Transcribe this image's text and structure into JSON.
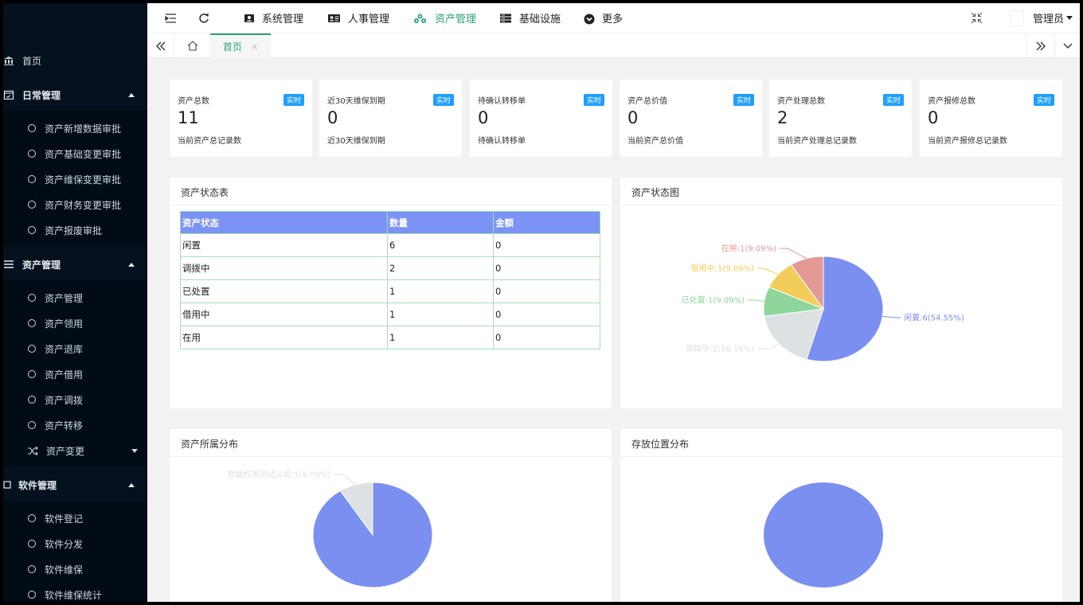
{
  "sidebar": {
    "home": "首页",
    "groups": [
      {
        "label": "日常管理",
        "items": [
          "资产新增数据审批",
          "资产基础变更审批",
          "资产维保变更审批",
          "资产财务变更审批",
          "资产报废审批"
        ]
      },
      {
        "label": "资产管理",
        "items": [
          "资产管理",
          "资产领用",
          "资产退库",
          "资产借用",
          "资产调拨",
          "资产转移",
          "资产变更"
        ]
      },
      {
        "label": "软件管理",
        "items": [
          "软件登记",
          "软件分发",
          "软件维保",
          "软件维保统计"
        ]
      }
    ]
  },
  "topbar": {
    "menus": [
      "系统管理",
      "人事管理",
      "资产管理",
      "基础设施",
      "更多"
    ],
    "active": "资产管理",
    "user": "管理员"
  },
  "tabs": {
    "home_tab": "首页"
  },
  "stats": [
    {
      "title": "资产总数",
      "badge": "实时",
      "value": "11",
      "desc": "当前资产总记录数"
    },
    {
      "title": "近30天维保到期",
      "badge": "实时",
      "value": "0",
      "desc": "近30天维保到期"
    },
    {
      "title": "待确认转移单",
      "badge": "实时",
      "value": "0",
      "desc": "待确认转移单"
    },
    {
      "title": "资产总价值",
      "badge": "实时",
      "value": "0",
      "desc": "当前资产总价值"
    },
    {
      "title": "资产处理总数",
      "badge": "实时",
      "value": "2",
      "desc": "当前资产处理总记录数"
    },
    {
      "title": "资产报修总数",
      "badge": "实时",
      "value": "0",
      "desc": "当前资产报修总记录数"
    }
  ],
  "status_table": {
    "title": "资产状态表",
    "headers": [
      "资产状态",
      "数量",
      "金额"
    ],
    "rows": [
      [
        "闲置",
        "6",
        "0"
      ],
      [
        "调拨中",
        "2",
        "0"
      ],
      [
        "已处置",
        "1",
        "0"
      ],
      [
        "借用中",
        "1",
        "0"
      ],
      [
        "在用",
        "1",
        "0"
      ]
    ]
  },
  "panels": {
    "status_chart": "资产状态图",
    "owner_chart": "资产所属分布",
    "location_chart": "存放位置分布"
  },
  "chart_data": [
    {
      "type": "pie",
      "title": "资产状态图",
      "slices": [
        {
          "label": "闲置:6(54.55%)",
          "value": 6,
          "color": "#7b8ff0"
        },
        {
          "label": "调拨中:2(18.18%)",
          "value": 2,
          "color": "#dde1e4"
        },
        {
          "label": "已处置:1(9.09%)",
          "value": 1,
          "color": "#8fd69c"
        },
        {
          "label": "借用中:1(9.09%)",
          "value": 1,
          "color": "#f2cd5c"
        },
        {
          "label": "在用:1(9.09%)",
          "value": 1,
          "color": "#e39a94"
        }
      ]
    },
    {
      "type": "pie",
      "title": "资产所属分布",
      "slices": [
        {
          "label": "",
          "value": 10,
          "color": "#7b8ff0"
        },
        {
          "label": "数据权限测试公司:1(9.09%)",
          "value": 1,
          "color": "#dde1e4"
        }
      ]
    },
    {
      "type": "pie",
      "title": "存放位置分布",
      "slices": [
        {
          "label": "",
          "value": 11,
          "color": "#7b8ff0"
        }
      ]
    }
  ]
}
